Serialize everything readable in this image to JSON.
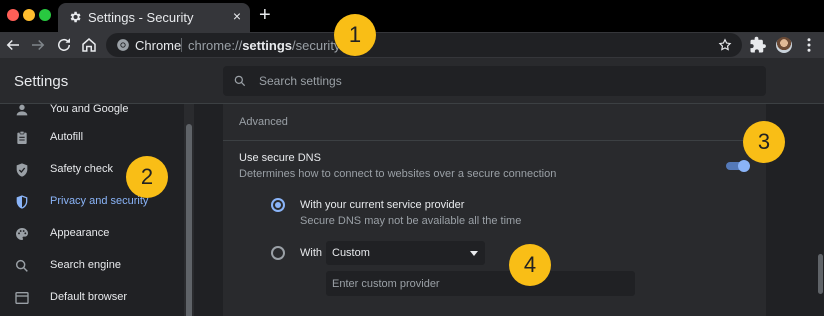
{
  "window": {
    "traffic_colors": [
      "#ff5f57",
      "#febc2e",
      "#28c840"
    ]
  },
  "tab": {
    "title": "Settings - Security",
    "icon": "gear-icon",
    "close": "×"
  },
  "toolbar": {
    "new_tab": "+",
    "site_label": "Chrome",
    "url_prefix": "chrome://",
    "url_host": "settings",
    "url_path": "/security"
  },
  "settings": {
    "title": "Settings",
    "search_placeholder": "Search settings"
  },
  "sidebar": {
    "items": [
      {
        "label": "You and Google",
        "icon": "person-icon",
        "active": false
      },
      {
        "label": "Autofill",
        "icon": "clipboard-icon",
        "active": false
      },
      {
        "label": "Safety check",
        "icon": "shield-check-icon",
        "active": false
      },
      {
        "label": "Privacy and security",
        "icon": "shield-icon",
        "active": true
      },
      {
        "label": "Appearance",
        "icon": "palette-icon",
        "active": false
      },
      {
        "label": "Search engine",
        "icon": "search-icon",
        "active": false
      },
      {
        "label": "Default browser",
        "icon": "browser-icon",
        "active": false
      }
    ]
  },
  "main": {
    "section_title": "Advanced",
    "secure_dns": {
      "title": "Use secure DNS",
      "description": "Determines how to connect to websites over a secure connection",
      "enabled": true
    },
    "option_current": {
      "label": "With your current service provider",
      "sublabel": "Secure DNS may not be available all the time",
      "checked": true
    },
    "option_custom": {
      "label": "With",
      "selected": "Custom",
      "input_placeholder": "Enter custom provider",
      "checked": false
    }
  },
  "callouts": [
    "1",
    "2",
    "3",
    "4"
  ],
  "colors": {
    "accent": "#8ab4f8",
    "callout": "#f9be16"
  }
}
